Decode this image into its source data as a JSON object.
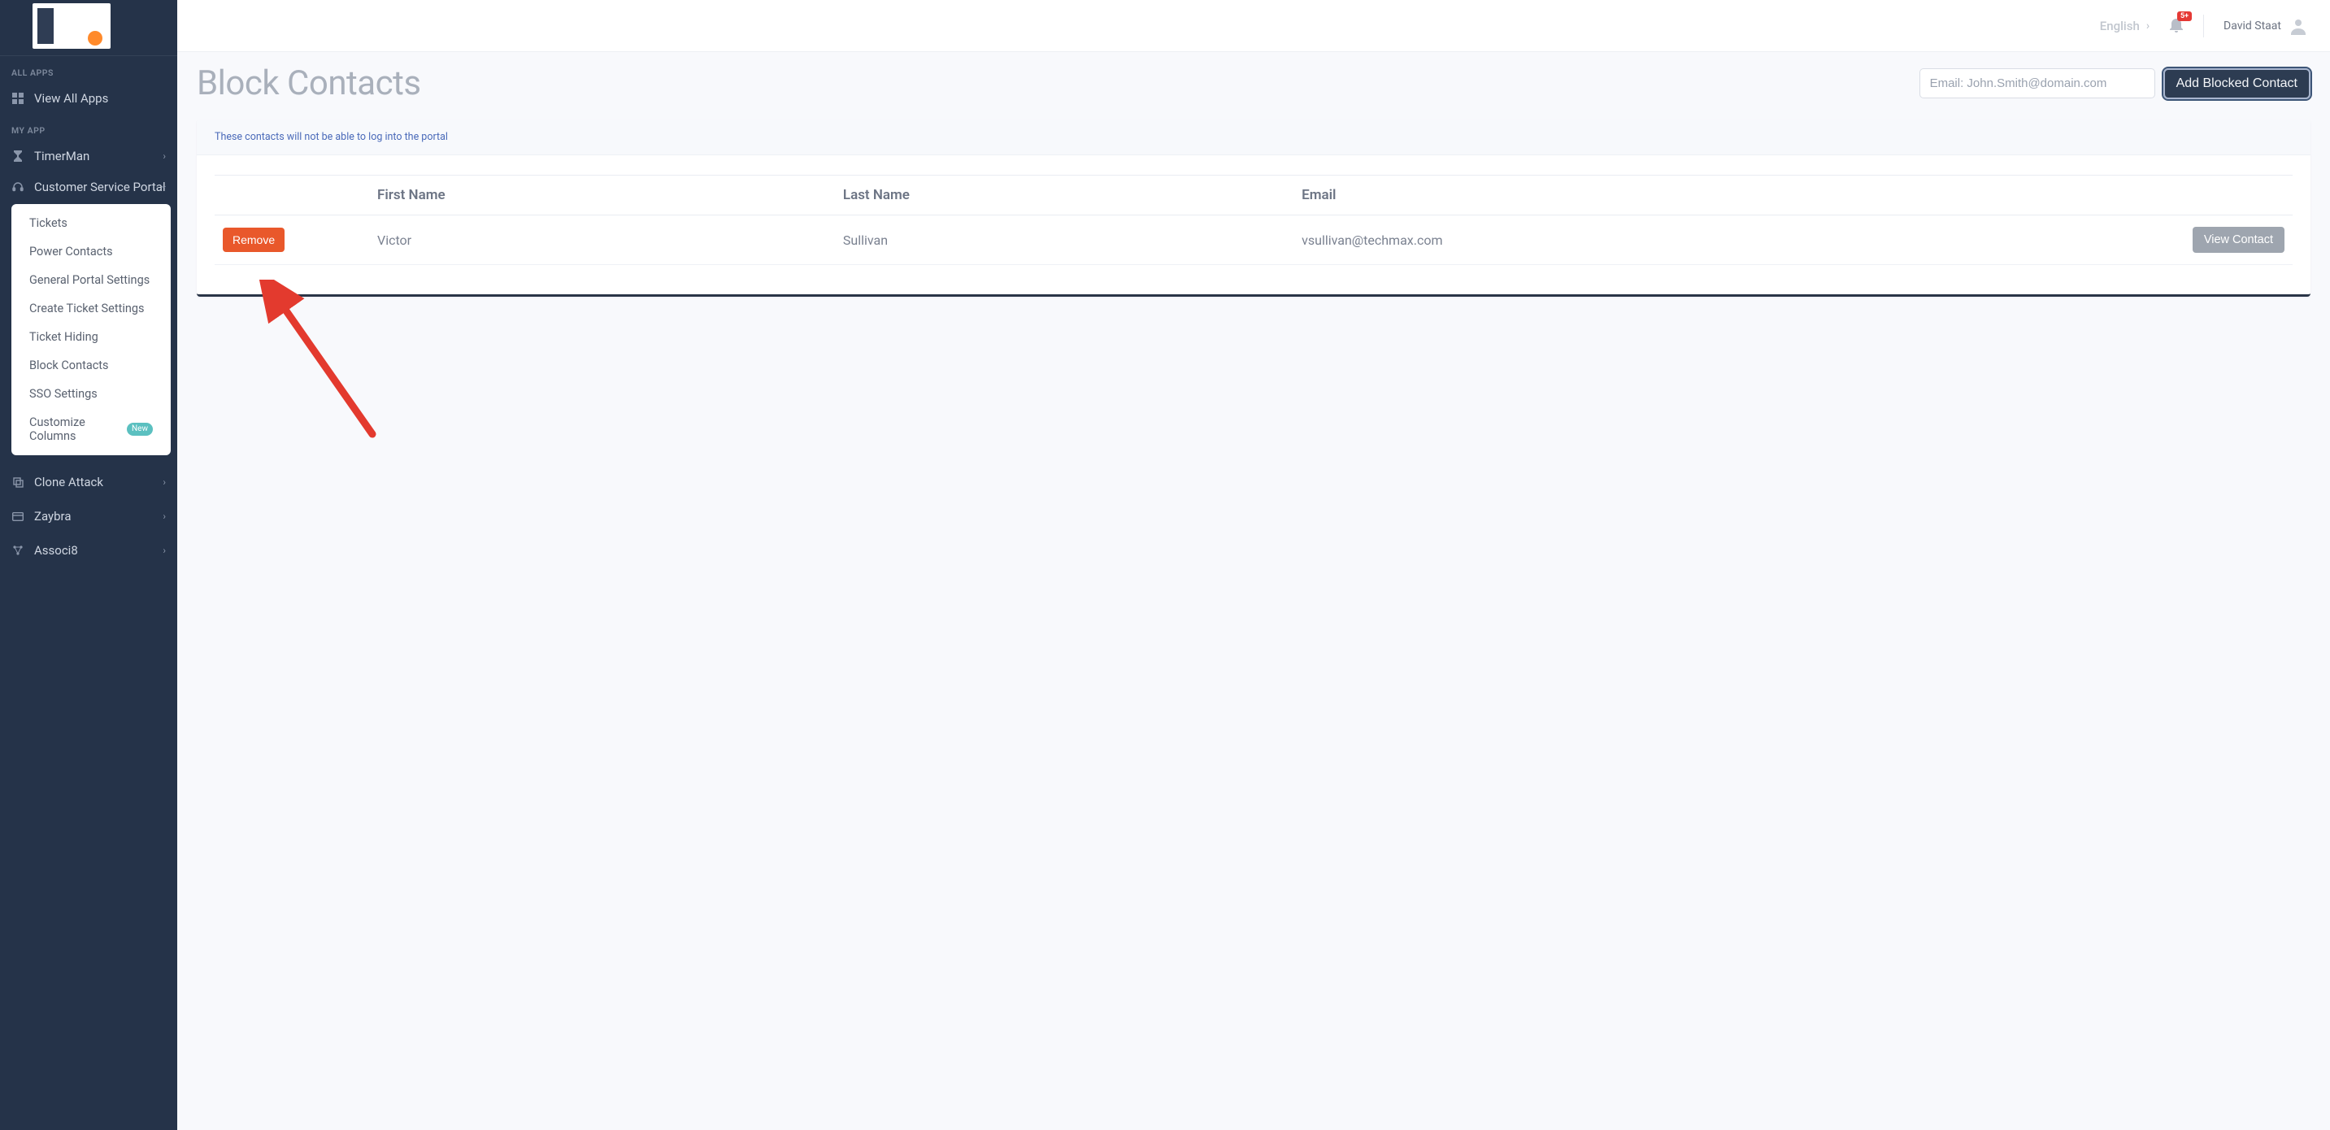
{
  "sidebar": {
    "section_all_apps": "ALL APPS",
    "view_all_apps": "View All Apps",
    "section_my_app": "MY APP",
    "items": [
      {
        "label": "TimerMan"
      },
      {
        "label": "Customer Service Portal"
      },
      {
        "label": "Clone Attack"
      },
      {
        "label": "Zaybra"
      },
      {
        "label": "Associ8"
      }
    ],
    "csp_submenu": [
      {
        "label": "Tickets"
      },
      {
        "label": "Power Contacts"
      },
      {
        "label": "General Portal Settings"
      },
      {
        "label": "Create Ticket Settings"
      },
      {
        "label": "Ticket Hiding"
      },
      {
        "label": "Block Contacts"
      },
      {
        "label": "SSO Settings"
      },
      {
        "label": "Customize Columns",
        "badge": "New"
      }
    ]
  },
  "topbar": {
    "language": "English",
    "notifications_badge": "5+",
    "user_name": "David Staat"
  },
  "page": {
    "title": "Block Contacts",
    "email_placeholder": "Email: John.Smith@domain.com",
    "add_button": "Add Blocked Contact",
    "note": "These contacts will not be able to log into the portal"
  },
  "table": {
    "columns": {
      "first_name": "First Name",
      "last_name": "Last Name",
      "email": "Email"
    },
    "remove_label": "Remove",
    "view_contact_label": "View Contact",
    "rows": [
      {
        "first_name": "Victor",
        "last_name": "Sullivan",
        "email": "vsullivan@techmax.com"
      }
    ]
  }
}
